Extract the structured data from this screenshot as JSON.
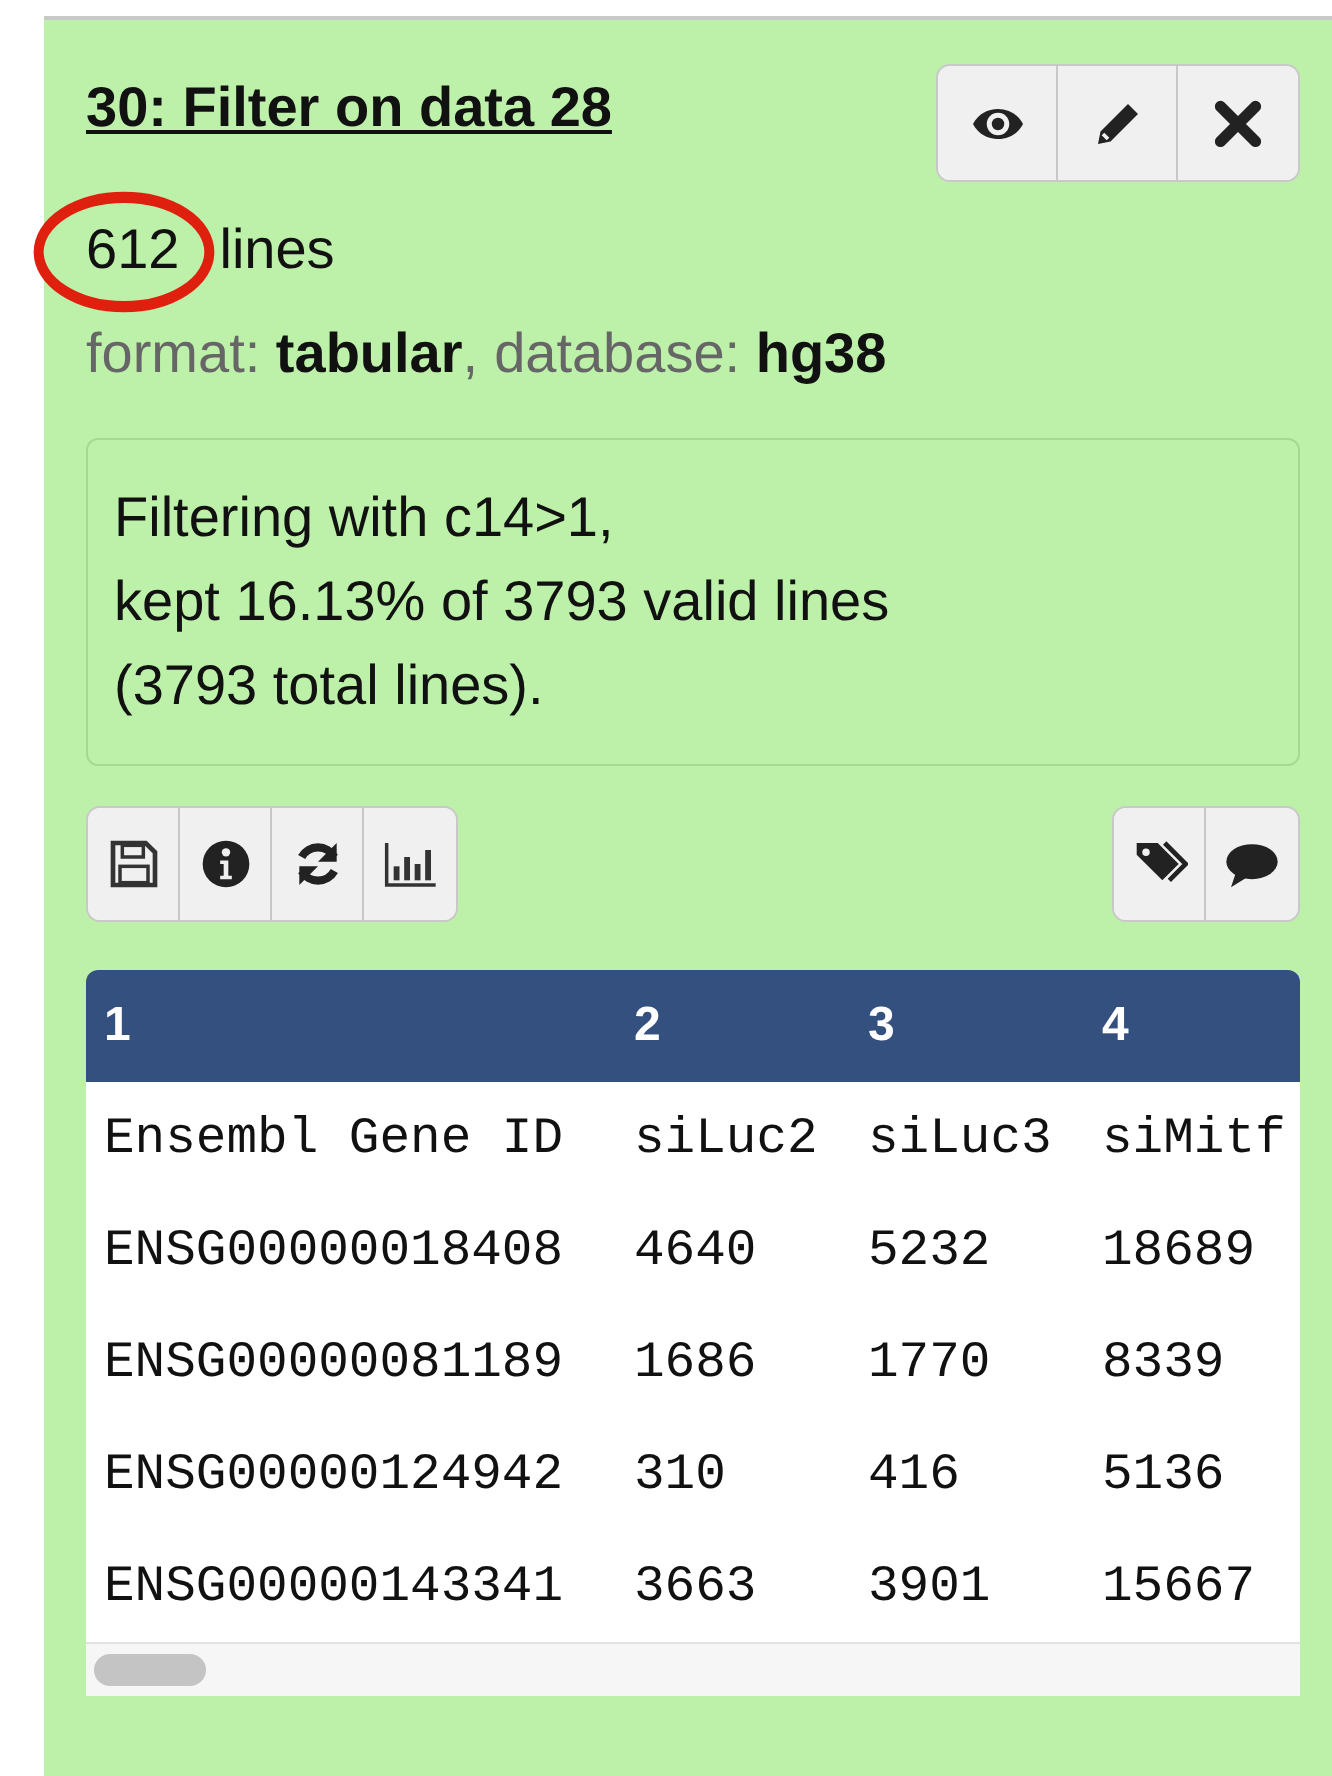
{
  "dataset": {
    "title": "30: Filter on data 28",
    "actions": [
      {
        "kind": "eye"
      },
      {
        "kind": "pencil"
      },
      {
        "kind": "close"
      }
    ],
    "line_count": {
      "count": "612",
      "label": "lines",
      "highlighted": true
    },
    "meta": [
      {
        "label": "format:",
        "value": "tabular",
        "separator": ","
      },
      {
        "label": "database:",
        "value": "hg38"
      }
    ],
    "info_lines": [
      "Filtering with c14>1,",
      "kept 16.13% of 3793 valid lines",
      "(3793 total lines)."
    ],
    "left_tools": [
      {
        "kind": "save"
      },
      {
        "kind": "info"
      },
      {
        "kind": "refresh"
      },
      {
        "kind": "chart"
      }
    ],
    "right_tools": [
      {
        "kind": "tags"
      },
      {
        "kind": "comment"
      }
    ],
    "table": {
      "columns": [
        "1",
        "2",
        "3",
        "4"
      ],
      "rows": [
        [
          "Ensembl Gene ID",
          "siLuc2",
          "siLuc3",
          "siMitf"
        ],
        [
          "ENSG00000018408",
          "4640",
          "5232",
          "18689"
        ],
        [
          "ENSG00000081189",
          "1686",
          "1770",
          "8339"
        ],
        [
          "ENSG00000124942",
          "310",
          "416",
          "5136"
        ],
        [
          "ENSG00000143341",
          "3663",
          "3901",
          "15667"
        ]
      ]
    }
  }
}
